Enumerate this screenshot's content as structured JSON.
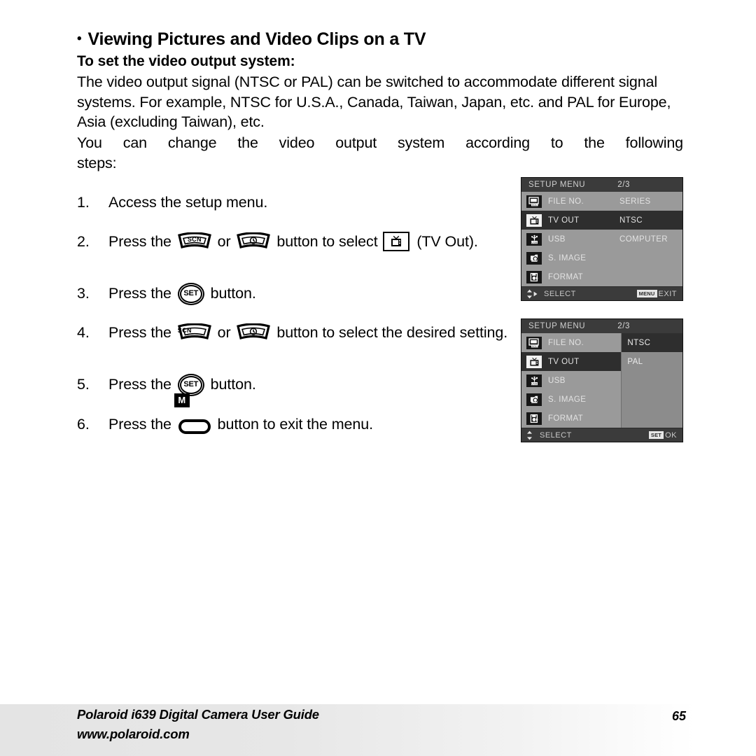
{
  "heading": {
    "bullet": "•",
    "title": "Viewing Pictures and Video Clips on a TV",
    "subtitle": "To set the video output system:"
  },
  "paragraphs": {
    "p1_line1": "The video output signal (NTSC or PAL) can be switched to accommodate",
    "p1_line2": "different signal systems. For example, NTSC for U.S.A., Canada, Taiwan,",
    "p1_line3": "Japan, etc. and PAL for Europe, Asia (excluding Taiwan), etc.",
    "p2_line1": "You can change the video output system according to the following",
    "p2_line2": "steps:"
  },
  "steps": {
    "s1": {
      "num": "1.",
      "text": "Access the setup menu."
    },
    "s2": {
      "num": "2.",
      "pre": "Press the",
      "or": "or",
      "mid": "button to select",
      "post": "(TV Out)."
    },
    "s3": {
      "num": "3.",
      "pre": "Press the",
      "post": "button."
    },
    "s4": {
      "num": "4.",
      "pre": "Press the",
      "or": "or",
      "post": "button to select the desired setting."
    },
    "s5": {
      "num": "5.",
      "pre": "Press the",
      "post": "button."
    },
    "s6": {
      "num": "6.",
      "pre": "Press the",
      "post": "button to exit the menu."
    }
  },
  "buttons": {
    "scn_label": "SCN",
    "set_label": "SET",
    "menu_badge": "M"
  },
  "lcd1": {
    "header_title": "SETUP MENU",
    "header_page": "2/3",
    "rows": [
      {
        "icon": "file-number-icon",
        "label": "FILE NO.",
        "value": "SERIES",
        "selected": false
      },
      {
        "icon": "tv-out-icon",
        "label": "TV OUT",
        "value": "NTSC",
        "selected": true
      },
      {
        "icon": "usb-icon",
        "label": "USB",
        "value": "COMPUTER",
        "selected": false
      },
      {
        "icon": "startup-image-icon",
        "label": "S. IMAGE",
        "value": "",
        "selected": false
      },
      {
        "icon": "format-icon",
        "label": "FORMAT",
        "value": "",
        "selected": false
      }
    ],
    "footer_select": "SELECT",
    "footer_key": "MENU",
    "footer_action": "EXIT"
  },
  "lcd2": {
    "header_title": "SETUP MENU",
    "header_page": "2/3",
    "rows": [
      {
        "icon": "file-number-icon",
        "label": "FILE NO.",
        "selected": false
      },
      {
        "icon": "tv-out-icon",
        "label": "TV OUT",
        "selected": true
      },
      {
        "icon": "usb-icon",
        "label": "USB",
        "selected": false
      },
      {
        "icon": "startup-image-icon",
        "label": "S. IMAGE",
        "selected": false
      },
      {
        "icon": "format-icon",
        "label": "FORMAT",
        "selected": false
      }
    ],
    "submenu": [
      {
        "label": "NTSC",
        "selected": true
      },
      {
        "label": "PAL",
        "selected": false
      }
    ],
    "footer_select": "SELECT",
    "footer_key": "SET",
    "footer_action": "OK"
  },
  "footer": {
    "title": "Polaroid i639 Digital Camera User Guide",
    "url": "www.polaroid.com",
    "page": "65"
  },
  "colors": {
    "lcd_body": "#9a9a9a",
    "lcd_header": "#3b3b3b",
    "lcd_highlight": "#2e2e2e",
    "lcd_submenu": "#8c8c8c",
    "text": "#000000"
  }
}
